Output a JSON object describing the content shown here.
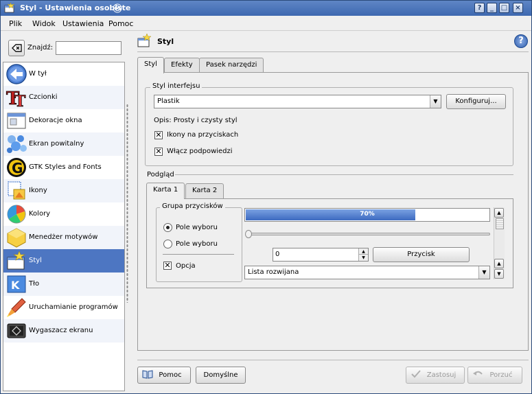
{
  "window": {
    "title": "Styl - Ustawienia osobiste"
  },
  "titlebar_buttons": [
    "?",
    "_",
    "□",
    "×"
  ],
  "menu": [
    {
      "label": "Plik"
    },
    {
      "label": "Widok"
    },
    {
      "label": "Ustawienia"
    },
    {
      "label": "Pomoc"
    }
  ],
  "search": {
    "label": "Znajdź:",
    "value": ""
  },
  "sidebar": {
    "items": [
      {
        "label": "W tył",
        "icon": "back-arrow-icon"
      },
      {
        "label": "Czcionki",
        "icon": "fonts-icon"
      },
      {
        "label": "Dekoracje okna",
        "icon": "window-decorations-icon"
      },
      {
        "label": "Ekran powitalny",
        "icon": "splash-screen-icon"
      },
      {
        "label": "GTK Styles and Fonts",
        "icon": "gtk-icon"
      },
      {
        "label": "Ikony",
        "icon": "icons-icon"
      },
      {
        "label": "Kolory",
        "icon": "colors-icon"
      },
      {
        "label": "Menedżer motywów",
        "icon": "theme-manager-icon"
      },
      {
        "label": "Styl",
        "icon": "style-icon",
        "selected": true
      },
      {
        "label": "Tło",
        "icon": "background-icon"
      },
      {
        "label": "Uruchamianie programów",
        "icon": "launch-feedback-icon"
      },
      {
        "label": "Wygaszacz ekranu",
        "icon": "screensaver-icon"
      }
    ]
  },
  "page": {
    "title": "Styl"
  },
  "tabs": [
    {
      "label": "Styl",
      "active": true
    },
    {
      "label": "Efekty"
    },
    {
      "label": "Pasek narzędzi"
    }
  ],
  "widget_style": {
    "group_title": "Styl interfejsu",
    "selected": "Plastik",
    "configure_label": "Konfiguruj...",
    "description": "Opis: Prosty i czysty styl",
    "options": [
      {
        "label": "Ikony na przyciskach",
        "checked": true
      },
      {
        "label": "Włącz podpowiedzi",
        "checked": true
      }
    ]
  },
  "preview": {
    "title": "Podgląd",
    "tabs": [
      {
        "label": "Karta 1",
        "active": true
      },
      {
        "label": "Karta 2"
      }
    ],
    "button_group": {
      "title": "Grupa przycisków",
      "radios": [
        {
          "label": "Pole wyboru",
          "checked": true
        },
        {
          "label": "Pole wyboru",
          "checked": false
        }
      ],
      "checkbox": {
        "label": "Opcja",
        "checked": true
      }
    },
    "progress": {
      "text": "70%",
      "value": 0.7
    },
    "slider": {
      "value": 0
    },
    "spinbox": {
      "value": "0"
    },
    "button_label": "Przycisk",
    "combo_value": "Lista rozwijana"
  },
  "bottom_buttons": {
    "help": "Pomoc",
    "defaults": "Domyślne",
    "apply": "Zastosuj",
    "reset": "Porzuć"
  },
  "colors": {
    "titlebar": "#4a74ba",
    "selection": "#4d76c2",
    "progress": "#3d6ac0",
    "window_bg": "#efefef"
  }
}
